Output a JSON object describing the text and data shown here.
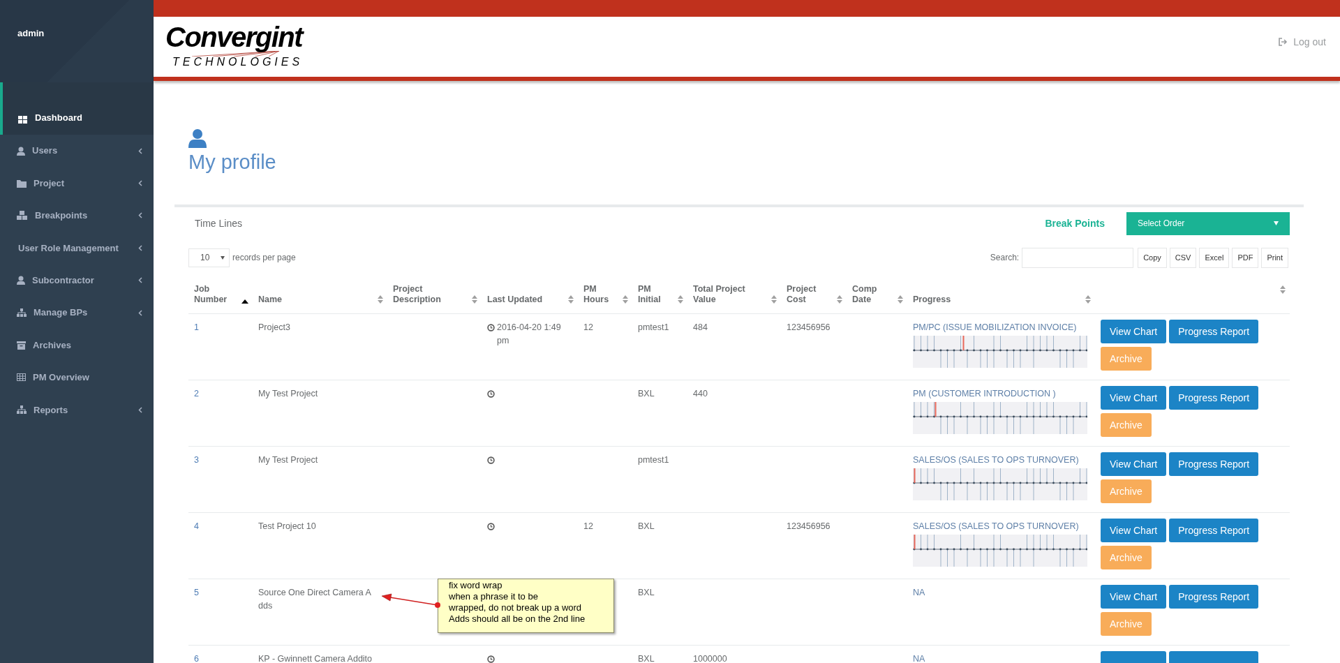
{
  "sidebar": {
    "user": "admin",
    "items": [
      {
        "label": "Dashboard",
        "selected": true,
        "submenu": false
      },
      {
        "label": "Users",
        "selected": false,
        "submenu": true
      },
      {
        "label": "Project",
        "selected": false,
        "submenu": true
      },
      {
        "label": "Breakpoints",
        "selected": false,
        "submenu": true
      },
      {
        "label": "User Role Management",
        "selected": false,
        "submenu": true
      },
      {
        "label": "Subcontractor",
        "selected": false,
        "submenu": true
      },
      {
        "label": "Manage BPs",
        "selected": false,
        "submenu": true
      },
      {
        "label": "Archives",
        "selected": false,
        "submenu": false
      },
      {
        "label": "PM Overview",
        "selected": false,
        "submenu": false
      },
      {
        "label": "Reports",
        "selected": false,
        "submenu": true
      }
    ]
  },
  "header": {
    "logo": {
      "name": "Convergint",
      "tagline": "TECHNOLOGIES"
    },
    "logout": "Log out"
  },
  "page_title": "My profile",
  "panel": {
    "title": "Time Lines",
    "break_points": "Break Points",
    "order_select": "Select Order",
    "page_size": "10",
    "page_size_label": "records per page",
    "search_label": "Search:",
    "export_buttons": [
      "Copy",
      "CSV",
      "Excel",
      "PDF",
      "Print"
    ]
  },
  "table": {
    "columns": [
      {
        "label": "Job Number",
        "sorted": true
      },
      {
        "label": "Name",
        "sorted": false
      },
      {
        "label": "Project Description",
        "sorted": false
      },
      {
        "label": "Last Updated",
        "sorted": false
      },
      {
        "label": "PM Hours",
        "sorted": false
      },
      {
        "label": "PM Initial",
        "sorted": false
      },
      {
        "label": "Total Project Value",
        "sorted": false
      },
      {
        "label": "Project Cost",
        "sorted": false
      },
      {
        "label": "Comp Date",
        "sorted": false
      },
      {
        "label": "Progress",
        "sorted": false
      },
      {
        "sorted": false
      }
    ],
    "rows": [
      {
        "job": "1",
        "name": "Project3",
        "updated_icon": true,
        "updated": "2016-04-20 1:49 pm",
        "pm_hours": "12",
        "pm_initial": "pmtest1",
        "total_value": "484",
        "cost": "123456956",
        "progress": {
          "label": "PM/PC (ISSUE MOBILIZATION INVOICE)",
          "level": 0.29
        },
        "actions": [
          {
            "label": "View Chart",
            "kind": "primary"
          },
          {
            "label": "Progress Report",
            "kind": "primary"
          },
          {
            "label": "Archive",
            "kind": "warning"
          }
        ]
      },
      {
        "job": "2",
        "name": "My Test Project",
        "updated_icon": true,
        "pm_initial": "BXL",
        "total_value": "440",
        "progress": {
          "label": "PM (CUSTOMER INTRODUCTION )",
          "level": 0.13
        },
        "actions": [
          {
            "label": "View Chart",
            "kind": "primary"
          },
          {
            "label": "Progress Report",
            "kind": "primary"
          },
          {
            "label": "Archive",
            "kind": "warning"
          }
        ]
      },
      {
        "job": "3",
        "name": "My Test Project",
        "updated_icon": true,
        "pm_initial": "pmtest1",
        "progress": {
          "label": "SALES/OS (SALES TO OPS TURNOVER)",
          "level": 0.01
        },
        "actions": [
          {
            "label": "View Chart",
            "kind": "primary"
          },
          {
            "label": "Progress Report",
            "kind": "primary"
          },
          {
            "label": "Archive",
            "kind": "warning"
          }
        ]
      },
      {
        "job": "4",
        "name": "Test Project 10",
        "updated_icon": true,
        "pm_hours": "12",
        "pm_initial": "BXL",
        "cost": "123456956",
        "progress": {
          "label": "SALES/OS (SALES TO OPS TURNOVER)",
          "level": 0.01
        },
        "actions": [
          {
            "label": "View Chart",
            "kind": "primary"
          },
          {
            "label": "Progress Report",
            "kind": "primary"
          },
          {
            "label": "Archive",
            "kind": "warning"
          }
        ]
      },
      {
        "job": "5",
        "name": "Source One Direct Camera Adds",
        "updated_icon": false,
        "pm_initial": "BXL",
        "progress": {
          "label": "NA"
        },
        "actions": [
          {
            "label": "View Chart",
            "kind": "primary"
          },
          {
            "label": "Progress Report",
            "kind": "primary"
          },
          {
            "label": "Archive",
            "kind": "warning"
          }
        ]
      },
      {
        "job": "6",
        "name": "KP - Gwinnett Camera Addito",
        "updated_icon": true,
        "pm_initial": "BXL",
        "total_value": "1000000",
        "progress": {
          "label": "NA"
        },
        "actions": [
          {
            "kind": "primary"
          },
          {
            "kind": "primary"
          }
        ]
      }
    ]
  },
  "annotation": {
    "text": "fix word wrap\nwhen a phrase it to be\nwrapped, do not break up a word\nAdds should all be on the 2nd line"
  }
}
